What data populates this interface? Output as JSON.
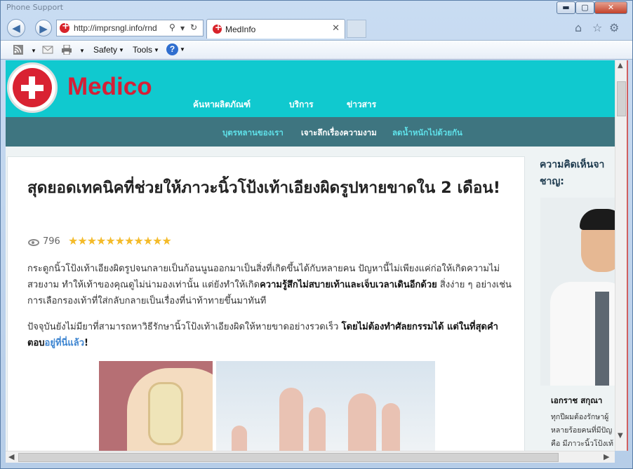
{
  "window": {
    "title": "Phone Support",
    "controls": {
      "minimize": "▬",
      "maximize": "▢",
      "close": "✕"
    }
  },
  "browser": {
    "address": "http://imprsngl.info/rnd",
    "tab_title": "MedInfo",
    "tab_close": "✕",
    "commands": {
      "safety": "Safety",
      "tools": "Tools",
      "help": "?"
    },
    "icons": [
      "back-icon",
      "forward-icon",
      "search-icon",
      "refresh-icon",
      "home-icon",
      "star-icon",
      "gear-icon",
      "rss-icon",
      "mail-icon",
      "print-icon"
    ]
  },
  "site": {
    "logo": "Medico",
    "top_nav": [
      "ค้นหาผลิตภัณฑ์",
      "บริการ",
      "ข่าวสาร"
    ],
    "sub_nav": [
      "บุตรหลานของเรา",
      "เจาะลึกเรื่องความงาม",
      "ลดน้ำหนักไปด้วยกัน"
    ],
    "sub_nav_active": 1
  },
  "article": {
    "headline": "สุดยอดเทคนิคที่ช่วยให้ภาวะนิ้วโป้งเท้าเอียงผิดรูปหายขาดใน 2 เดือน!",
    "views": "796",
    "stars": "★★★★★★★★★★★",
    "p1_a": "กระดูกนิ้วโป้งเท้าเอียงผิดรูปจนกลายเป็นก้อนนูนออกมาเป็นสิ่งที่เกิดขึ้นได้กับหลายคน ปัญหานี้ไม่เพียงแค่ก่อให้เกิดความไม่สวยงาม ทำให้เท้าของคุณดูไม่น่ามองเท่านั้น แต่ยังทำให้เกิด",
    "p1_b": "ความรู้สึกไม่สบายเท้าและเจ็บเวลาเดินอีกด้วย",
    "p1_c": " สิ่งง่าย ๆ อย่างเช่น การเลือกรองเท้าที่ใส่กลับกลายเป็นเรื่องที่น่าท้าทายขึ้นมาทันที",
    "p2_a": "ปัจจุบันยังไม่มียาที่สามารถหาวิธีรักษานิ้วโป้งเท้าเอียงผิดให้หายขาดอย่างรวดเร็ว ",
    "p2_b": "โดยไม่ต้องทำศัลยกรรมได้ แต่ในที่สุดคำตอบ",
    "p2_link": "อยู่ที่นี่แล้ว",
    "p2_end": "!"
  },
  "sidebar": {
    "title_line1": "ความคิดเห็นจา",
    "title_line2": "ชาญ:",
    "doctor_name": "เอกราช สกุณา",
    "doctor_text": [
      "ทุกปีผมต้องรักษาผู้",
      "หลายร้อยคนที่มีปัญ",
      "คือ มีภาวะนิ้วโป้งเท้"
    ]
  }
}
